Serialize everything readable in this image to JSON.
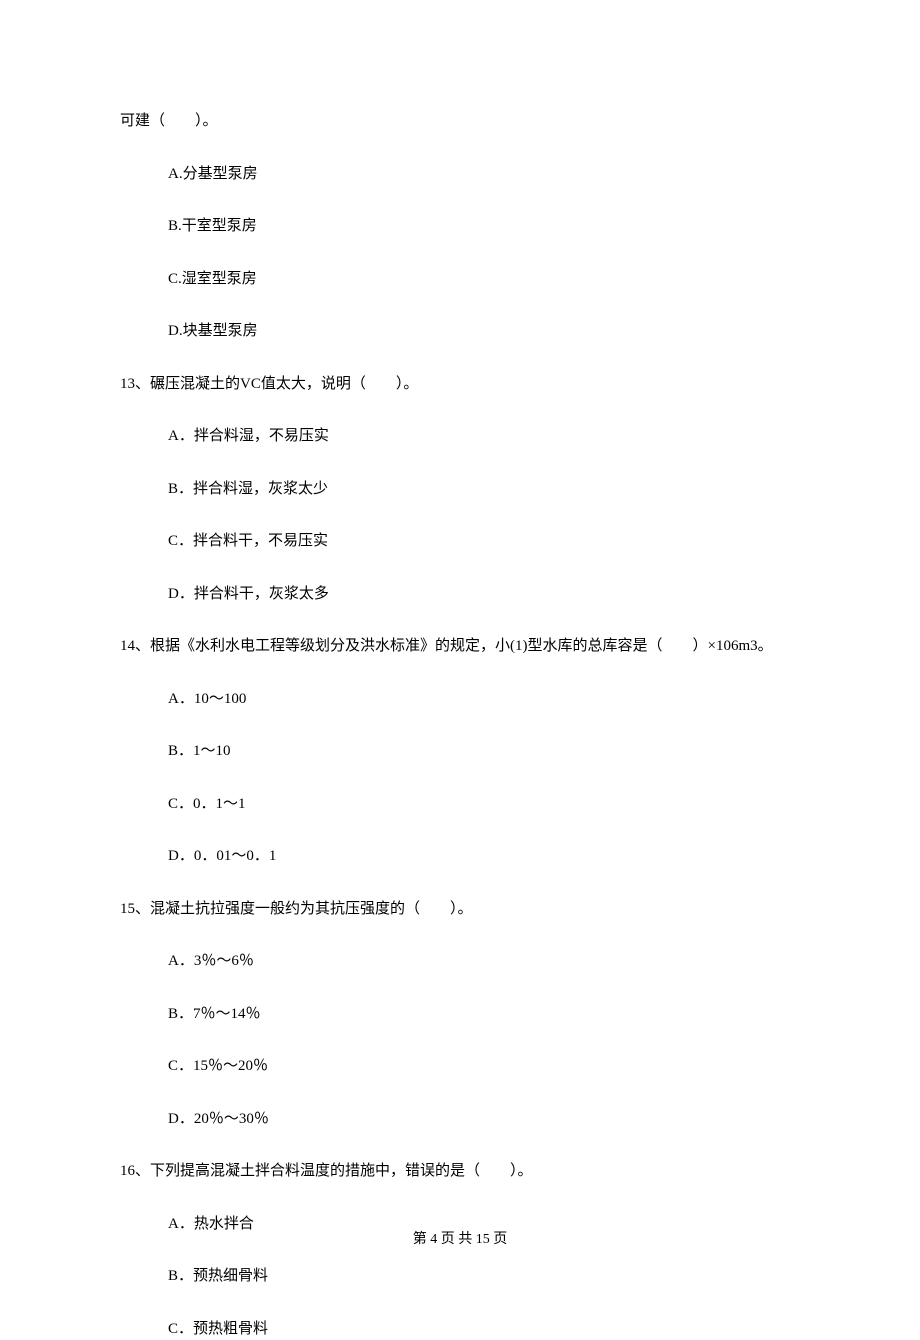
{
  "q12_tail": "可建（　　）。",
  "q12_options": {
    "A": "A.分基型泵房",
    "B": "B.干室型泵房",
    "C": "C.湿室型泵房",
    "D": "D.块基型泵房"
  },
  "q13_stem": "13、碾压混凝土的VC值太大，说明（　　）。",
  "q13_options": {
    "A": "A．拌合料湿，不易压实",
    "B": "B．拌合料湿，灰浆太少",
    "C": "C．拌合料干，不易压实",
    "D": "D．拌合料干，灰浆太多"
  },
  "q14_stem": "14、根据《水利水电工程等级划分及洪水标准》的规定，小(1)型水库的总库容是（　　）×106m3。",
  "q14_options": {
    "A": "A．10～100",
    "B": "B．1～10",
    "C": "C．0．1～1",
    "D": "D．0．01～0．1"
  },
  "q15_stem": "15、混凝土抗拉强度一般约为其抗压强度的（　　）。",
  "q15_options": {
    "A": "A．3％～6％",
    "B": "B．7％～14％",
    "C": "C．15％～20％",
    "D": "D．20％～30％"
  },
  "q16_stem": "16、下列提高混凝土拌合料温度的措施中，错误的是（　　）。",
  "q16_options": {
    "A": "A．热水拌合",
    "B": "B．预热细骨料",
    "C": "C．预热粗骨料"
  },
  "footer": "第 4 页 共 15 页"
}
